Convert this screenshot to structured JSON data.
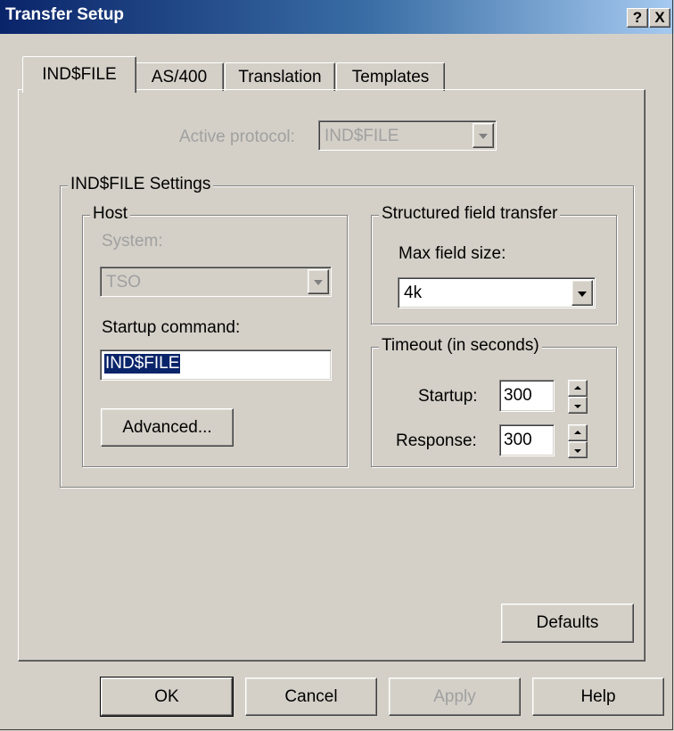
{
  "window": {
    "title": "Transfer Setup",
    "help_glyph": "?",
    "close_glyph": "X"
  },
  "tabs": [
    {
      "label": "IND$FILE",
      "active": true
    },
    {
      "label": "AS/400",
      "active": false
    },
    {
      "label": "Translation",
      "active": false
    },
    {
      "label": "Templates",
      "active": false
    }
  ],
  "protocol": {
    "label": "Active protocol:",
    "value": "IND$FILE",
    "enabled": false
  },
  "settings_group": {
    "title": "IND$FILE Settings"
  },
  "host": {
    "title": "Host",
    "system_label": "System:",
    "system_value": "TSO",
    "startup_command_label": "Startup command:",
    "startup_command_value": "IND$FILE",
    "advanced_button": "Advanced..."
  },
  "structured": {
    "title": "Structured field transfer",
    "max_field_label": "Max field size:",
    "max_field_value": "4k"
  },
  "timeout": {
    "title": "Timeout (in seconds)",
    "startup_label": "Startup:",
    "startup_value": "300",
    "response_label": "Response:",
    "response_value": "300"
  },
  "defaults_button": "Defaults",
  "footer": {
    "ok": "OK",
    "cancel": "Cancel",
    "apply": "Apply",
    "help": "Help"
  },
  "colors": {
    "title_gradient_start": "#0a246a",
    "title_gradient_end": "#a6caf0",
    "face": "#d4d0c8",
    "selection": "#0a246a"
  }
}
